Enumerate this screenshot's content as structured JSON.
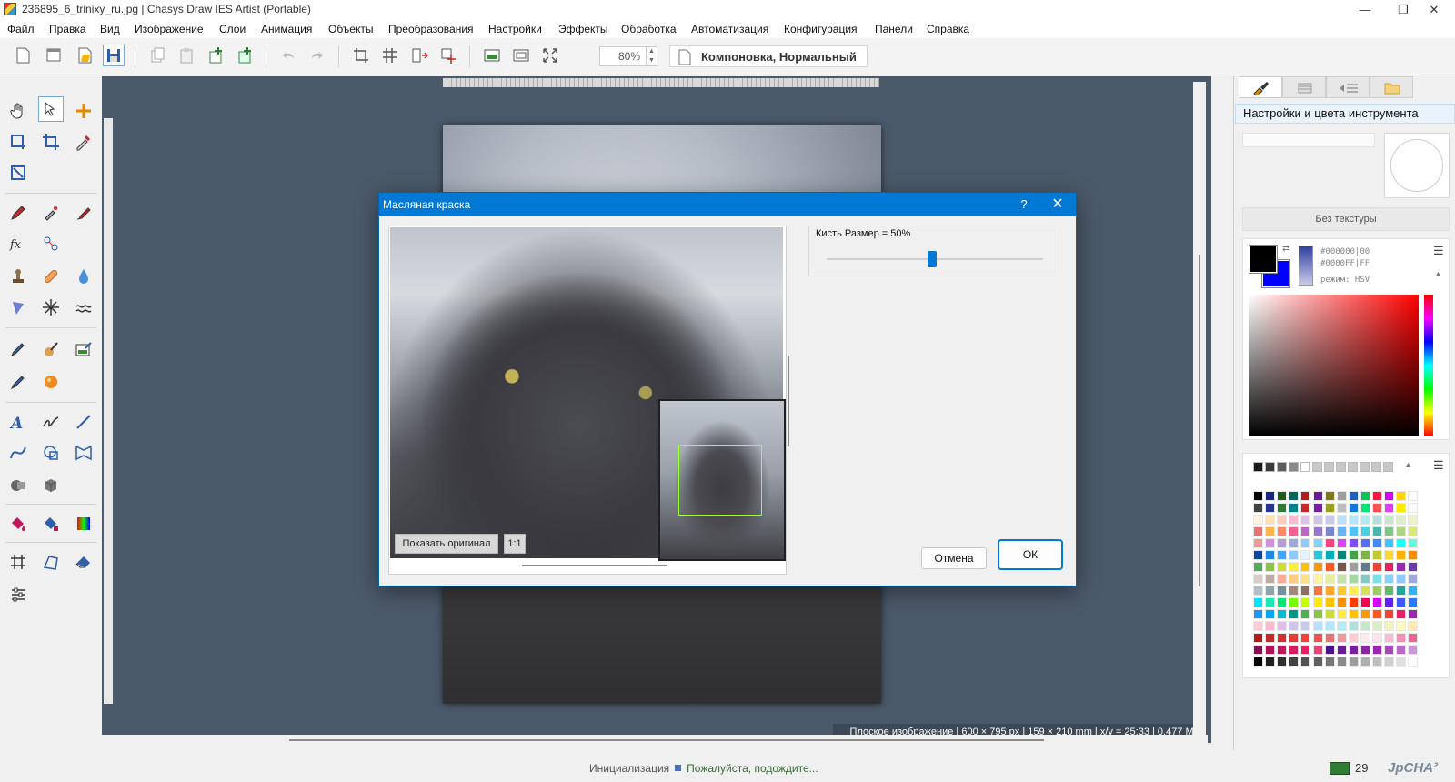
{
  "window": {
    "title": "236895_6_trinixy_ru.jpg | Chasys Draw IES Artist (Portable)",
    "minimize": "—",
    "maximize": "❐",
    "close": "✕"
  },
  "menu": [
    "Файл",
    "Правка",
    "Вид",
    "Изображение",
    "Слои",
    "Анимация",
    "Объекты",
    "Преобразования",
    "Настройки",
    "Эффекты",
    "Обработка",
    "Автоматизация",
    "Конфигурация",
    "Панели",
    "Справка"
  ],
  "toolbar": {
    "zoom_value": "80%",
    "mode_label": "Компоновка, Нормальный"
  },
  "canvas": {
    "status_info": "Плоское изображение | 600 × 795 px | 159 × 210 mm | x/y = 25:33 | 0.477 MP"
  },
  "right_panel": {
    "header": "Настройки и цвета инструмента",
    "texture_label": "Без текстуры",
    "fg_hex": "#000000|00",
    "bg_hex": "#0000FF|FF",
    "mode": "режим: HSV",
    "colors": {
      "foreground": "#000000",
      "background": "#0000ff",
      "accent": "#0078d4"
    }
  },
  "dialog": {
    "title": "Масляная краска",
    "help": "?",
    "close": "✕",
    "brush_size_label": "Кисть Размер = 50%",
    "brush_size_value": 50,
    "show_original": "Показать оригинал",
    "one_to_one": "1:1",
    "cancel": "Отмена",
    "ok": "ОК"
  },
  "statusbar": {
    "init": "Инициализация",
    "wait": "Пожалуйста, подождите...",
    "count": "29",
    "brand": "JpCHA²"
  }
}
